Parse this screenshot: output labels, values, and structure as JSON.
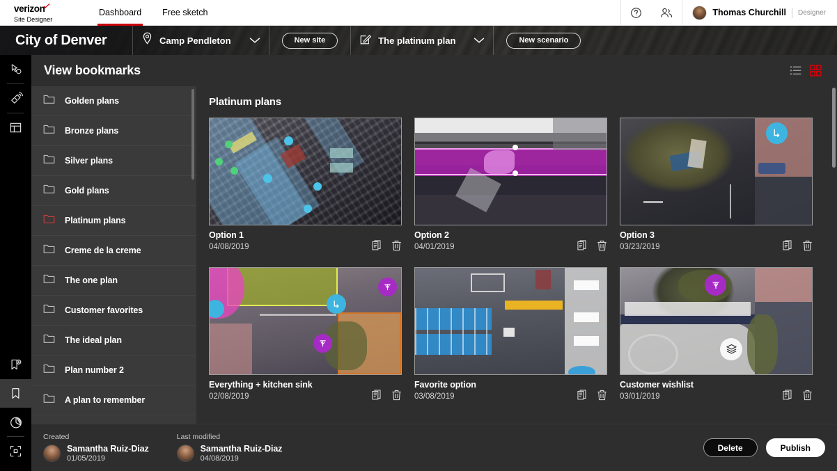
{
  "topbar": {
    "logo": "verizon",
    "logo_sub": "Site Designer",
    "nav": [
      {
        "label": "Dashboard",
        "active": true
      },
      {
        "label": "Free sketch",
        "active": false
      }
    ],
    "help_icon": "help-circle-icon",
    "people_icon": "people-icon",
    "user": {
      "name": "Thomas Churchill",
      "role": "Designer"
    }
  },
  "banner": {
    "title": "City of Denver",
    "location_icon": "location-pin-icon",
    "location": "Camp Pendleton",
    "location_chevron": "chevron-down-icon",
    "new_site_label": "New site",
    "plan_icon": "edit-square-icon",
    "plan": "The platinum plan",
    "plan_chevron": "chevron-down-icon",
    "new_scenario_label": "New scenario"
  },
  "rail": {
    "top_items": [
      {
        "icon": "cursor-select-icon",
        "active": false
      },
      {
        "icon": "satellite-icon",
        "active": false
      },
      {
        "icon": "layout-panel-icon",
        "active": false
      }
    ],
    "bottom_items": [
      {
        "icon": "bookmark-add-icon",
        "active": false
      },
      {
        "icon": "bookmark-icon",
        "active": true
      },
      {
        "icon": "pie-chart-icon",
        "active": false
      },
      {
        "icon": "fullscreen-icon",
        "active": false
      }
    ]
  },
  "panel": {
    "title": "View bookmarks",
    "view_modes": [
      {
        "icon": "list-view-icon",
        "active": false,
        "color": "#9a9a9a"
      },
      {
        "icon": "grid-view-icon",
        "active": true,
        "color": "#cd040b"
      }
    ]
  },
  "folders": {
    "active_color": "#cd3b3b",
    "items": [
      {
        "icon": "folder-icon",
        "label": "Golden plans",
        "active": false
      },
      {
        "icon": "folder-icon",
        "label": "Bronze plans",
        "active": false
      },
      {
        "icon": "folder-icon",
        "label": "Silver plans",
        "active": false
      },
      {
        "icon": "folder-icon",
        "label": "Gold plans",
        "active": false
      },
      {
        "icon": "folder-icon",
        "label": "Platinum plans",
        "active": true
      },
      {
        "icon": "folder-icon",
        "label": "Creme de la creme",
        "active": false
      },
      {
        "icon": "folder-icon",
        "label": "The one plan",
        "active": false
      },
      {
        "icon": "folder-icon",
        "label": "Customer favorites",
        "active": false
      },
      {
        "icon": "folder-icon",
        "label": "The ideal plan",
        "active": false
      },
      {
        "icon": "folder-icon",
        "label": "Plan number 2",
        "active": false
      },
      {
        "icon": "folder-icon",
        "label": "A plan to remember",
        "active": false
      }
    ]
  },
  "cards": {
    "section_title": "Platinum plans",
    "copy_icon": "copy-icon",
    "delete_icon": "trash-icon",
    "items": [
      {
        "name": "Option 1",
        "date": "04/08/2019",
        "thumb": "t1"
      },
      {
        "name": "Option 2",
        "date": "04/01/2019",
        "thumb": "t2"
      },
      {
        "name": "Option 3",
        "date": "03/23/2019",
        "thumb": "t3"
      },
      {
        "name": "Everything + kitchen sink",
        "date": "02/08/2019",
        "thumb": "t4"
      },
      {
        "name": "Favorite option",
        "date": "03/08/2019",
        "thumb": "t5"
      },
      {
        "name": "Customer wishlist",
        "date": "03/01/2019",
        "thumb": "t6"
      }
    ]
  },
  "footer": {
    "created_label": "Created",
    "created_name": "Samantha Ruiz-Diaz",
    "created_date": "01/05/2019",
    "modified_label": "Last modified",
    "modified_name": "Samantha Ruiz-Diaz",
    "modified_date": "04/08/2019",
    "delete_label": "Delete",
    "publish_label": "Publish"
  }
}
